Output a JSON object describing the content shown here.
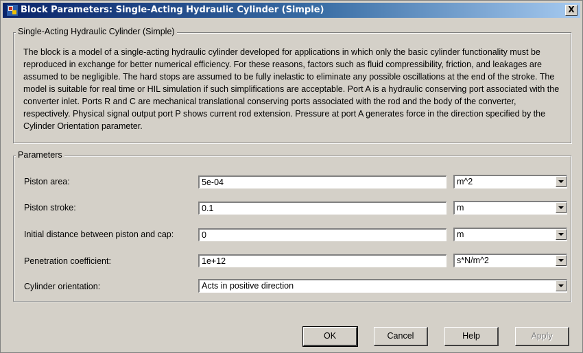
{
  "window": {
    "title": "Block Parameters: Single-Acting Hydraulic Cylinder (Simple)",
    "close_label": "X"
  },
  "description": {
    "group_title": "Single-Acting Hydraulic Cylinder (Simple)",
    "text": "The block is a model of a single-acting hydraulic cylinder developed for applications in which only the basic cylinder functionality must be reproduced in exchange for better numerical efficiency. For these reasons, factors such as fluid compressibility, friction, and leakages are assumed to be negligible. The hard stops are assumed to be fully inelastic to eliminate any possible oscillations at the end of the stroke. The model is suitable for real time or HIL simulation if such simplifications are acceptable. Port A is a hydraulic conserving port associated with the converter inlet. Ports R and C are mechanical translational conserving ports associated with the rod and the body of the converter, respectively. Physical signal output port P shows current rod extension. Pressure at port A generates force in the direction specified by the Cylinder Orientation parameter."
  },
  "parameters": {
    "group_title": "Parameters",
    "rows": [
      {
        "label": "Piston area:",
        "value": "5e-04",
        "unit": "m^2"
      },
      {
        "label": "Piston stroke:",
        "value": "0.1",
        "unit": "m"
      },
      {
        "label": "Initial distance between piston and cap:",
        "value": "0",
        "unit": "m"
      },
      {
        "label": "Penetration coefficient:",
        "value": "1e+12",
        "unit": "s*N/m^2"
      }
    ],
    "orientation": {
      "label": "Cylinder orientation:",
      "value": "Acts in positive direction"
    }
  },
  "buttons": {
    "ok": "OK",
    "cancel": "Cancel",
    "help": "Help",
    "apply": "Apply"
  }
}
